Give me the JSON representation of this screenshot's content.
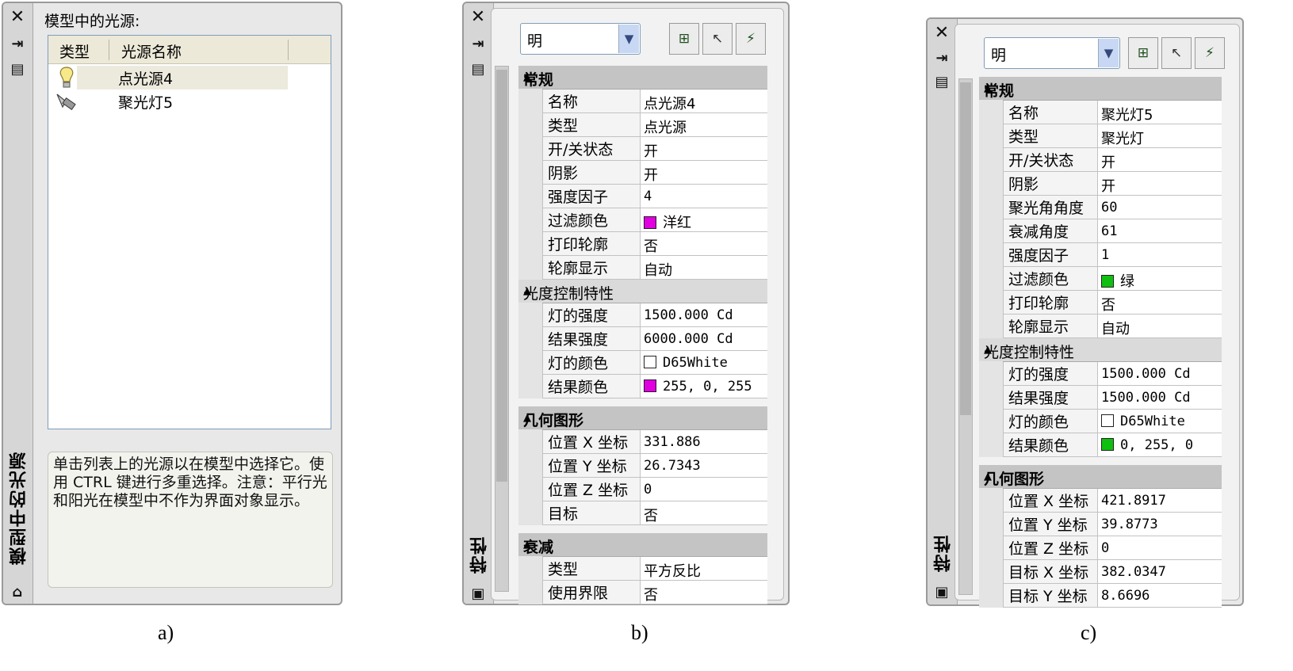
{
  "panel_a": {
    "title": "模型中的光源:",
    "vertical_title": "模型中的光源",
    "col_type": "类型",
    "col_name": "光源名称",
    "rows": [
      {
        "icon": "bulb-icon",
        "name": "点光源4"
      },
      {
        "icon": "spotlight-icon",
        "name": "聚光灯5"
      }
    ],
    "description": "单击列表上的光源以在模型中选择它。使用 CTRL 键进行多重选择。注意：平行光和阳光在模型中不作为界面对象显示。",
    "caption": "a)"
  },
  "panel_b": {
    "combo_value": "明",
    "vertical_title": "特性",
    "caption": "b)",
    "sections": {
      "general": "常规",
      "photometric": "光度控制特性",
      "geometry": "几何图形",
      "attenuation": "衰减"
    },
    "general_rows": [
      {
        "k": "名称",
        "v": "点光源4"
      },
      {
        "k": "类型",
        "v": "点光源"
      },
      {
        "k": "开/关状态",
        "v": "开"
      },
      {
        "k": "阴影",
        "v": "开"
      },
      {
        "k": "强度因子",
        "v": "4"
      },
      {
        "k": "过滤颜色",
        "v": "洋红"
      },
      {
        "k": "打印轮廓",
        "v": "否"
      },
      {
        "k": "轮廓显示",
        "v": "自动"
      }
    ],
    "photometric_rows": [
      {
        "k": "灯的强度",
        "v": "1500.000 Cd"
      },
      {
        "k": "结果强度",
        "v": "6000.000 Cd"
      },
      {
        "k": "灯的颜色",
        "v": "D65White"
      },
      {
        "k": "结果颜色",
        "v": "255, 0, 255"
      }
    ],
    "geometry_rows": [
      {
        "k": "位置 X 坐标",
        "v": "331.886"
      },
      {
        "k": "位置 Y 坐标",
        "v": "26.7343"
      },
      {
        "k": "位置 Z 坐标",
        "v": "0"
      },
      {
        "k": "目标",
        "v": "否"
      }
    ],
    "attenuation_rows": [
      {
        "k": "类型",
        "v": "平方反比"
      },
      {
        "k": "使用界限",
        "v": "否"
      }
    ],
    "colors": {
      "magenta": "#e000e0",
      "white": "#ffffff"
    }
  },
  "panel_c": {
    "combo_value": "明",
    "vertical_title": "特性",
    "caption": "c)",
    "sections": {
      "general": "常规",
      "photometric": "光度控制特性",
      "geometry": "几何图形"
    },
    "general_rows": [
      {
        "k": "名称",
        "v": "聚光灯5"
      },
      {
        "k": "类型",
        "v": "聚光灯"
      },
      {
        "k": "开/关状态",
        "v": "开"
      },
      {
        "k": "阴影",
        "v": "开"
      },
      {
        "k": "聚光角角度",
        "v": "60"
      },
      {
        "k": "衰减角度",
        "v": "61"
      },
      {
        "k": "强度因子",
        "v": "1"
      },
      {
        "k": "过滤颜色",
        "v": "绿"
      },
      {
        "k": "打印轮廓",
        "v": "否"
      },
      {
        "k": "轮廓显示",
        "v": "自动"
      }
    ],
    "photometric_rows": [
      {
        "k": "灯的强度",
        "v": "1500.000 Cd"
      },
      {
        "k": "结果强度",
        "v": "1500.000 Cd"
      },
      {
        "k": "灯的颜色",
        "v": "D65White"
      },
      {
        "k": "结果颜色",
        "v": "0, 255, 0"
      }
    ],
    "geometry_rows": [
      {
        "k": "位置 X 坐标",
        "v": "421.8917"
      },
      {
        "k": "位置 Y 坐标",
        "v": "39.8773"
      },
      {
        "k": "位置 Z 坐标",
        "v": "0"
      },
      {
        "k": "目标 X 坐标",
        "v": "382.0347"
      },
      {
        "k": "目标 Y 坐标",
        "v": "8.6696"
      }
    ],
    "colors": {
      "green": "#10c010",
      "white": "#ffffff"
    }
  }
}
